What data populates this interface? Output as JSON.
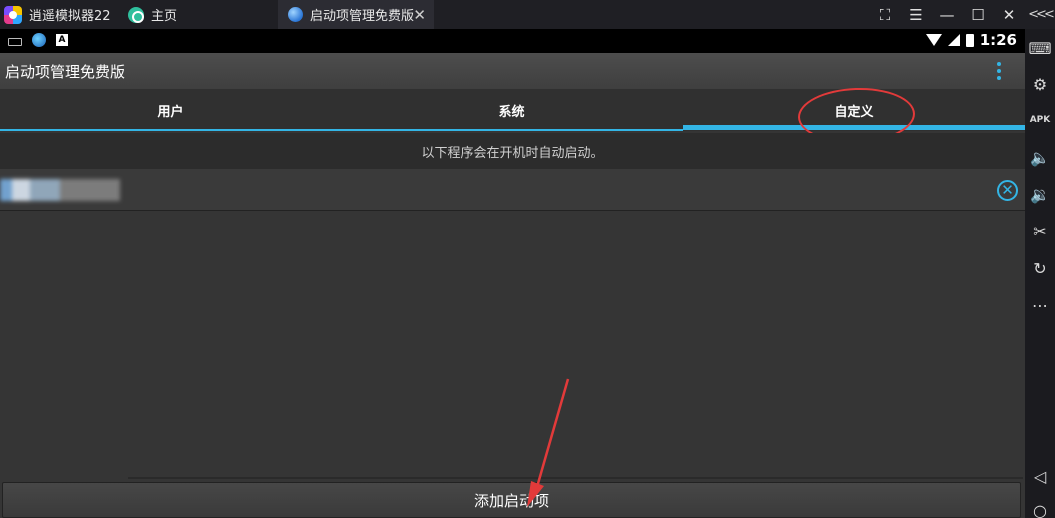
{
  "window": {
    "app_tab_label": "逍遥模拟器22",
    "home_tab_label": "主页",
    "active_tab_label": "启动项管理免费版",
    "close_glyph": "✕",
    "fullscreen_icon": "fullscreen-icon",
    "menu_icon": "menu-icon",
    "minimize_icon": "minimize-icon",
    "maximize_icon": "maximize-icon",
    "exit_icon": "close-icon",
    "collapse_icon": "collapse-icon"
  },
  "statusbar": {
    "time": "1:26"
  },
  "app": {
    "title": "启动项管理免费版",
    "tabs": [
      {
        "label": "用户"
      },
      {
        "label": "系统"
      },
      {
        "label": "自定义"
      }
    ],
    "active_tab": "自定义",
    "notice": "以下程序会在开机时自动启动。",
    "add_button_label": "添加启动项"
  },
  "sidebar": {
    "items": [
      "keyboard-icon",
      "settings-icon",
      "apk-icon",
      "volume-up-icon",
      "volume-down-icon",
      "cut-icon",
      "rotate-icon",
      "more-icon",
      "back-icon",
      "home-icon"
    ]
  },
  "colors": {
    "accent": "#33b5e5",
    "annotation": "#e23a3a"
  }
}
